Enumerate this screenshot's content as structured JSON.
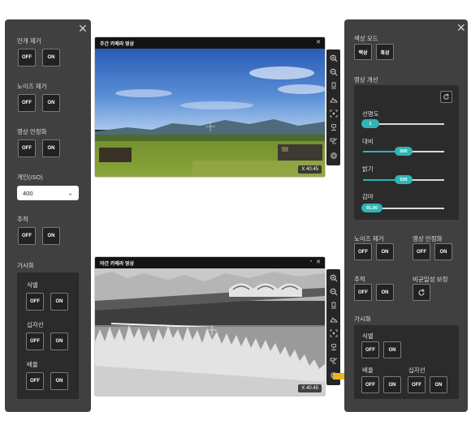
{
  "left_panel": {
    "remove_fog": {
      "label": "안개 제거",
      "off": "OFF",
      "on": "ON"
    },
    "noise_reduction": {
      "label": "노이즈 제거",
      "off": "OFF",
      "on": "ON"
    },
    "stabilization": {
      "label": "영상 안정화",
      "off": "OFF",
      "on": "ON"
    },
    "gain": {
      "label": "게인(ISO)",
      "value": "400"
    },
    "tracking": {
      "label": "추적",
      "off": "OFF",
      "on": "ON"
    },
    "visualization": {
      "label": "가시화",
      "identify": {
        "label": "식별",
        "off": "OFF",
        "on": "ON"
      },
      "crosshair": {
        "label": "십자선",
        "off": "OFF",
        "on": "ON"
      },
      "magnify": {
        "label": "배율",
        "off": "OFF",
        "on": "ON"
      }
    }
  },
  "day_camera": {
    "title": "주간 카메라 영상",
    "zoom": "X 40.45"
  },
  "night_camera": {
    "title": "야간 카메라 영상",
    "zoom": "X 40.45"
  },
  "right_panel": {
    "color_mode": {
      "label": "색상 모드",
      "white": "백상",
      "black": "흑상"
    },
    "image_enhance": {
      "label": "영상 개선",
      "sharpness": {
        "label": "선명도",
        "value": "1",
        "fraction": 0.05
      },
      "contrast": {
        "label": "대비",
        "value": "500",
        "fraction": 0.5
      },
      "brightness": {
        "label": "밝기",
        "value": "500",
        "fraction": 0.5
      },
      "gamma": {
        "label": "감마",
        "value": "01.00",
        "fraction": 0.1
      }
    },
    "noise_reduction": {
      "label": "노이즈 제거",
      "off": "OFF",
      "on": "ON"
    },
    "stabilization": {
      "label": "영상 안정화",
      "off": "OFF",
      "on": "ON"
    },
    "tracking": {
      "label": "추적",
      "off": "OFF",
      "on": "ON"
    },
    "nonuniformity": {
      "label": "비균일성 보정"
    },
    "visualization": {
      "label": "가시화",
      "identify": {
        "label": "식별",
        "off": "OFF",
        "on": "ON"
      },
      "magnify": {
        "label": "배율",
        "off": "OFF",
        "on": "ON"
      },
      "crosshair": {
        "label": "십자선",
        "off": "OFF",
        "on": "ON"
      }
    }
  },
  "colors": {
    "accent": "#2fb5b5",
    "arrow": "#f2b418",
    "panel": "#404040"
  }
}
